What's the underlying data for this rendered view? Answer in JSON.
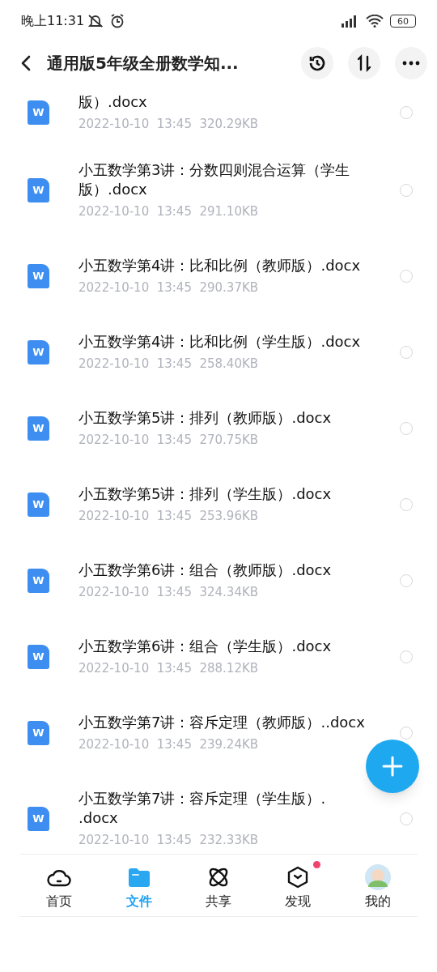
{
  "status_bar": {
    "time": "晚上11:31",
    "battery": "60"
  },
  "header": {
    "title": "通用版5年级全册数学知..."
  },
  "files": [
    {
      "name": "版）.docx",
      "date": "2022-10-10",
      "time": "13:45",
      "size": "320.29KB",
      "icon": "W",
      "selected": false
    },
    {
      "name": "小五数学第3讲：分数四则混合运算（学生版）.docx",
      "date": "2022-10-10",
      "time": "13:45",
      "size": "291.10KB",
      "icon": "W",
      "selected": false
    },
    {
      "name": "小五数学第4讲：比和比例（教师版）.docx",
      "date": "2022-10-10",
      "time": "13:45",
      "size": "290.37KB",
      "icon": "W",
      "selected": false
    },
    {
      "name": "小五数学第4讲：比和比例（学生版）.docx",
      "date": "2022-10-10",
      "time": "13:45",
      "size": "258.40KB",
      "icon": "W",
      "selected": false
    },
    {
      "name": "小五数学第5讲：排列（教师版）.docx",
      "date": "2022-10-10",
      "time": "13:45",
      "size": "270.75KB",
      "icon": "W",
      "selected": false
    },
    {
      "name": "小五数学第5讲：排列（学生版）.docx",
      "date": "2022-10-10",
      "time": "13:45",
      "size": "253.96KB",
      "icon": "W",
      "selected": false
    },
    {
      "name": "小五数学第6讲：组合（教师版）.docx",
      "date": "2022-10-10",
      "time": "13:45",
      "size": "324.34KB",
      "icon": "W",
      "selected": false
    },
    {
      "name": "小五数学第6讲：组合（学生版）.docx",
      "date": "2022-10-10",
      "time": "13:45",
      "size": "288.12KB",
      "icon": "W",
      "selected": false
    },
    {
      "name": "小五数学第7讲：容斥定理（教师版）..docx",
      "date": "2022-10-10",
      "time": "13:45",
      "size": "239.24KB",
      "icon": "W",
      "selected": false
    },
    {
      "name": "小五数学第7讲：容斥定理（学生版）. .docx",
      "date": "2022-10-10",
      "time": "13:45",
      "size": "232.33KB",
      "icon": "W",
      "selected": false
    }
  ],
  "tabs": [
    {
      "label": "首页",
      "kind": "home",
      "selected": false,
      "badge": false
    },
    {
      "label": "文件",
      "kind": "files",
      "selected": true,
      "badge": false
    },
    {
      "label": "共享",
      "kind": "share",
      "selected": false,
      "badge": false
    },
    {
      "label": "发现",
      "kind": "discover",
      "selected": false,
      "badge": true
    },
    {
      "label": "我的",
      "kind": "profile",
      "selected": false,
      "badge": false
    }
  ]
}
